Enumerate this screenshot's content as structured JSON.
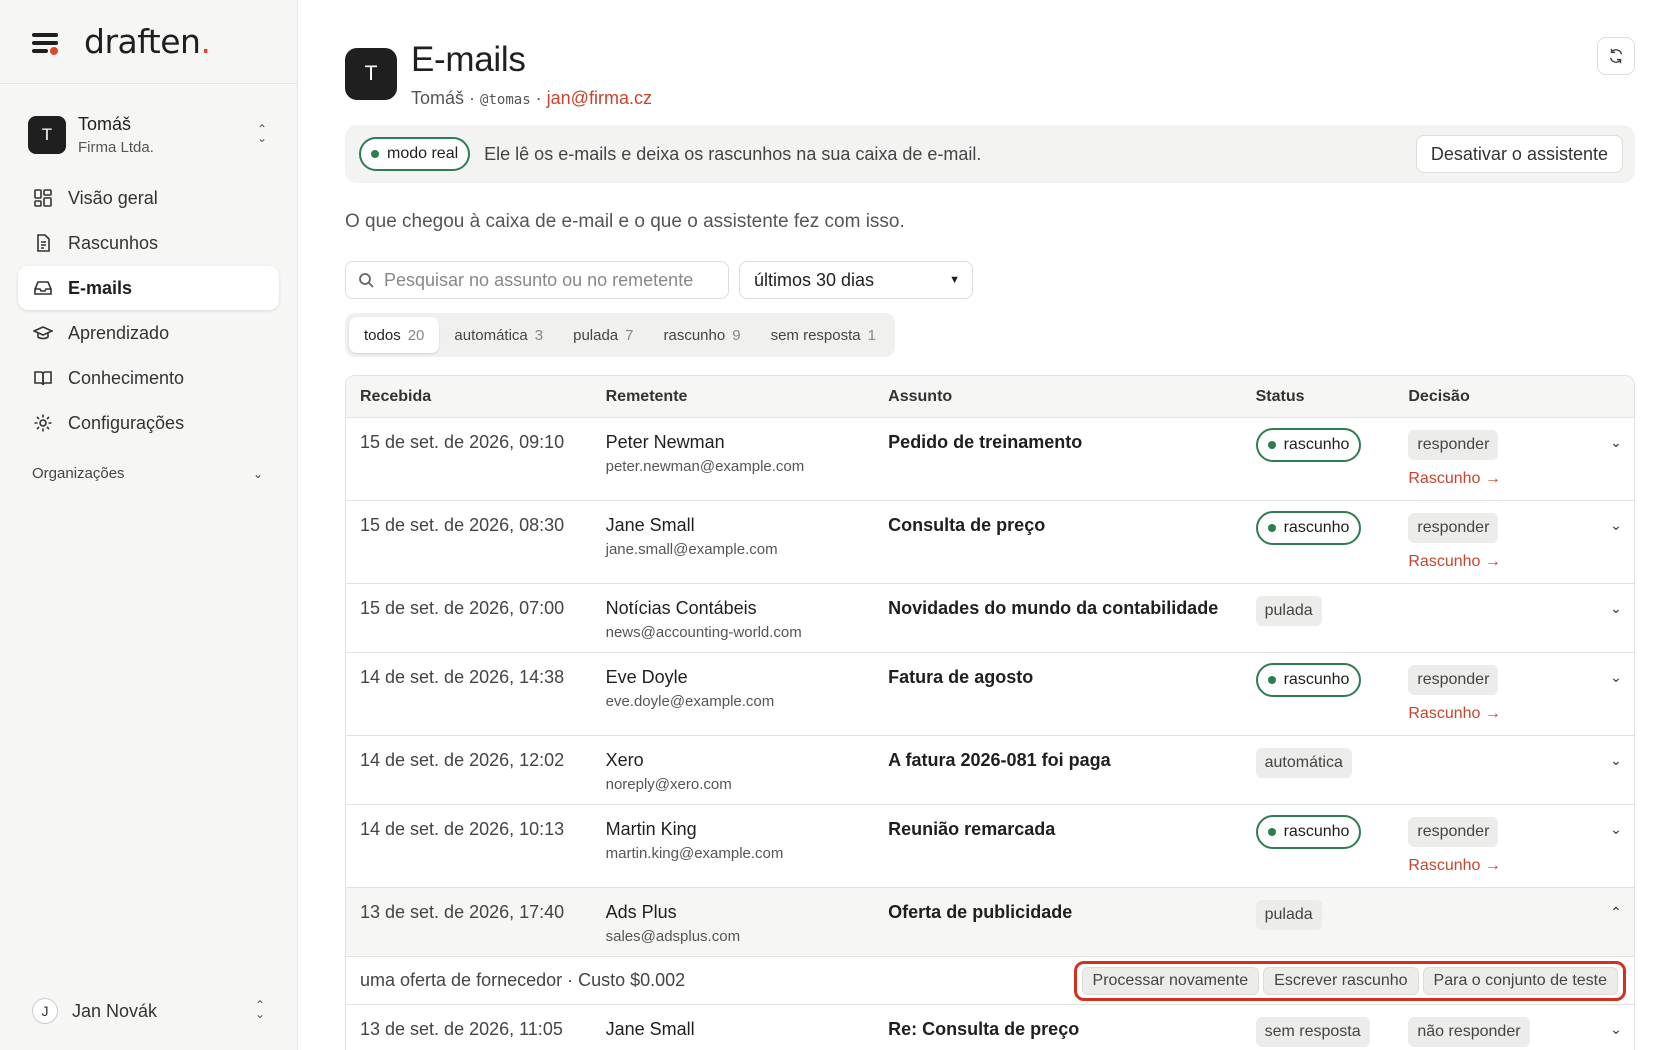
{
  "sidebar": {
    "logo": "draften",
    "logo_dot": ".",
    "account": {
      "initial": "T",
      "name": "Tomáš",
      "org": "Firma Ltda."
    },
    "nav": [
      {
        "label": "Visão geral",
        "icon": "dashboard-icon"
      },
      {
        "label": "Rascunhos",
        "icon": "document-icon"
      },
      {
        "label": "E-mails",
        "icon": "inbox-icon",
        "active": true
      },
      {
        "label": "Aprendizado",
        "icon": "graduation-cap-icon"
      },
      {
        "label": "Conhecimento",
        "icon": "book-icon"
      },
      {
        "label": "Configurações",
        "icon": "gear-icon"
      }
    ],
    "orgs_label": "Organizações",
    "user": {
      "initial": "J",
      "name": "Jan Novák"
    }
  },
  "header": {
    "avatar_initial": "T",
    "title": "E-mails",
    "user_name": "Tomáš",
    "separator": "·",
    "handle": "@tomas",
    "email": "jan@firma.cz"
  },
  "banner": {
    "mode_label": "modo real",
    "text": "Ele lê os e-mails e deixa os rascunhos na sua caixa de e-mail.",
    "deactivate_label": "Desativar o assistente"
  },
  "description": "O que chegou à caixa de e-mail e o que o assistente fez com isso.",
  "filters": {
    "search_placeholder": "Pesquisar no assunto ou no remetente",
    "period": "últimos 30 dias"
  },
  "tabs": [
    {
      "label": "todos",
      "count": "20"
    },
    {
      "label": "automática",
      "count": "3"
    },
    {
      "label": "pulada",
      "count": "7"
    },
    {
      "label": "rascunho",
      "count": "9"
    },
    {
      "label": "sem resposta",
      "count": "1"
    }
  ],
  "table": {
    "columns": {
      "received": "Recebida",
      "sender": "Remetente",
      "subject": "Assunto",
      "status": "Status",
      "decision": "Decisão"
    },
    "draft_link": "Rascunho →",
    "rows": [
      {
        "date": "15 de set. de 2026, 09:10",
        "name": "Peter Newman",
        "email": "peter.newman@example.com",
        "subject": "Pedido de treinamento",
        "status": "rascunho",
        "decision": "responder"
      },
      {
        "date": "15 de set. de 2026, 08:30",
        "name": "Jane Small",
        "email": "jane.small@example.com",
        "subject": "Consulta de preço",
        "status": "rascunho",
        "decision": "responder"
      },
      {
        "date": "15 de set. de 2026, 07:00",
        "name": "Notícias Contábeis",
        "email": "news@accounting-world.com",
        "subject": "Novidades do mundo da contabilidade",
        "status": "pulada",
        "decision": ""
      },
      {
        "date": "14 de set. de 2026, 14:38",
        "name": "Eve Doyle",
        "email": "eve.doyle@example.com",
        "subject": "Fatura de agosto",
        "status": "rascunho",
        "decision": "responder"
      },
      {
        "date": "14 de set. de 2026, 12:02",
        "name": "Xero",
        "email": "noreply@xero.com",
        "subject": "A fatura 2026-081 foi paga",
        "status": "automática",
        "decision": ""
      },
      {
        "date": "14 de set. de 2026, 10:13",
        "name": "Martin King",
        "email": "martin.king@example.com",
        "subject": "Reunião remarcada",
        "status": "rascunho",
        "decision": "responder"
      },
      {
        "date": "13 de set. de 2026, 17:40",
        "name": "Ads Plus",
        "email": "sales@adsplus.com",
        "subject": "Oferta de publicidade",
        "status": "pulada",
        "decision": ""
      },
      {
        "date": "13 de set. de 2026, 11:05",
        "name": "Jane Small",
        "email": "",
        "subject": "Re: Consulta de preço",
        "status": "sem resposta",
        "decision": "não responder"
      }
    ],
    "detail": {
      "text": "uma oferta de fornecedor · Custo $0.002",
      "actions": [
        "Processar novamente",
        "Escrever rascunho",
        "Para o conjunto de teste"
      ]
    }
  },
  "colors": {
    "accent": "#c8442c",
    "green": "#2e7d4f",
    "highlight": "#d4301f"
  }
}
